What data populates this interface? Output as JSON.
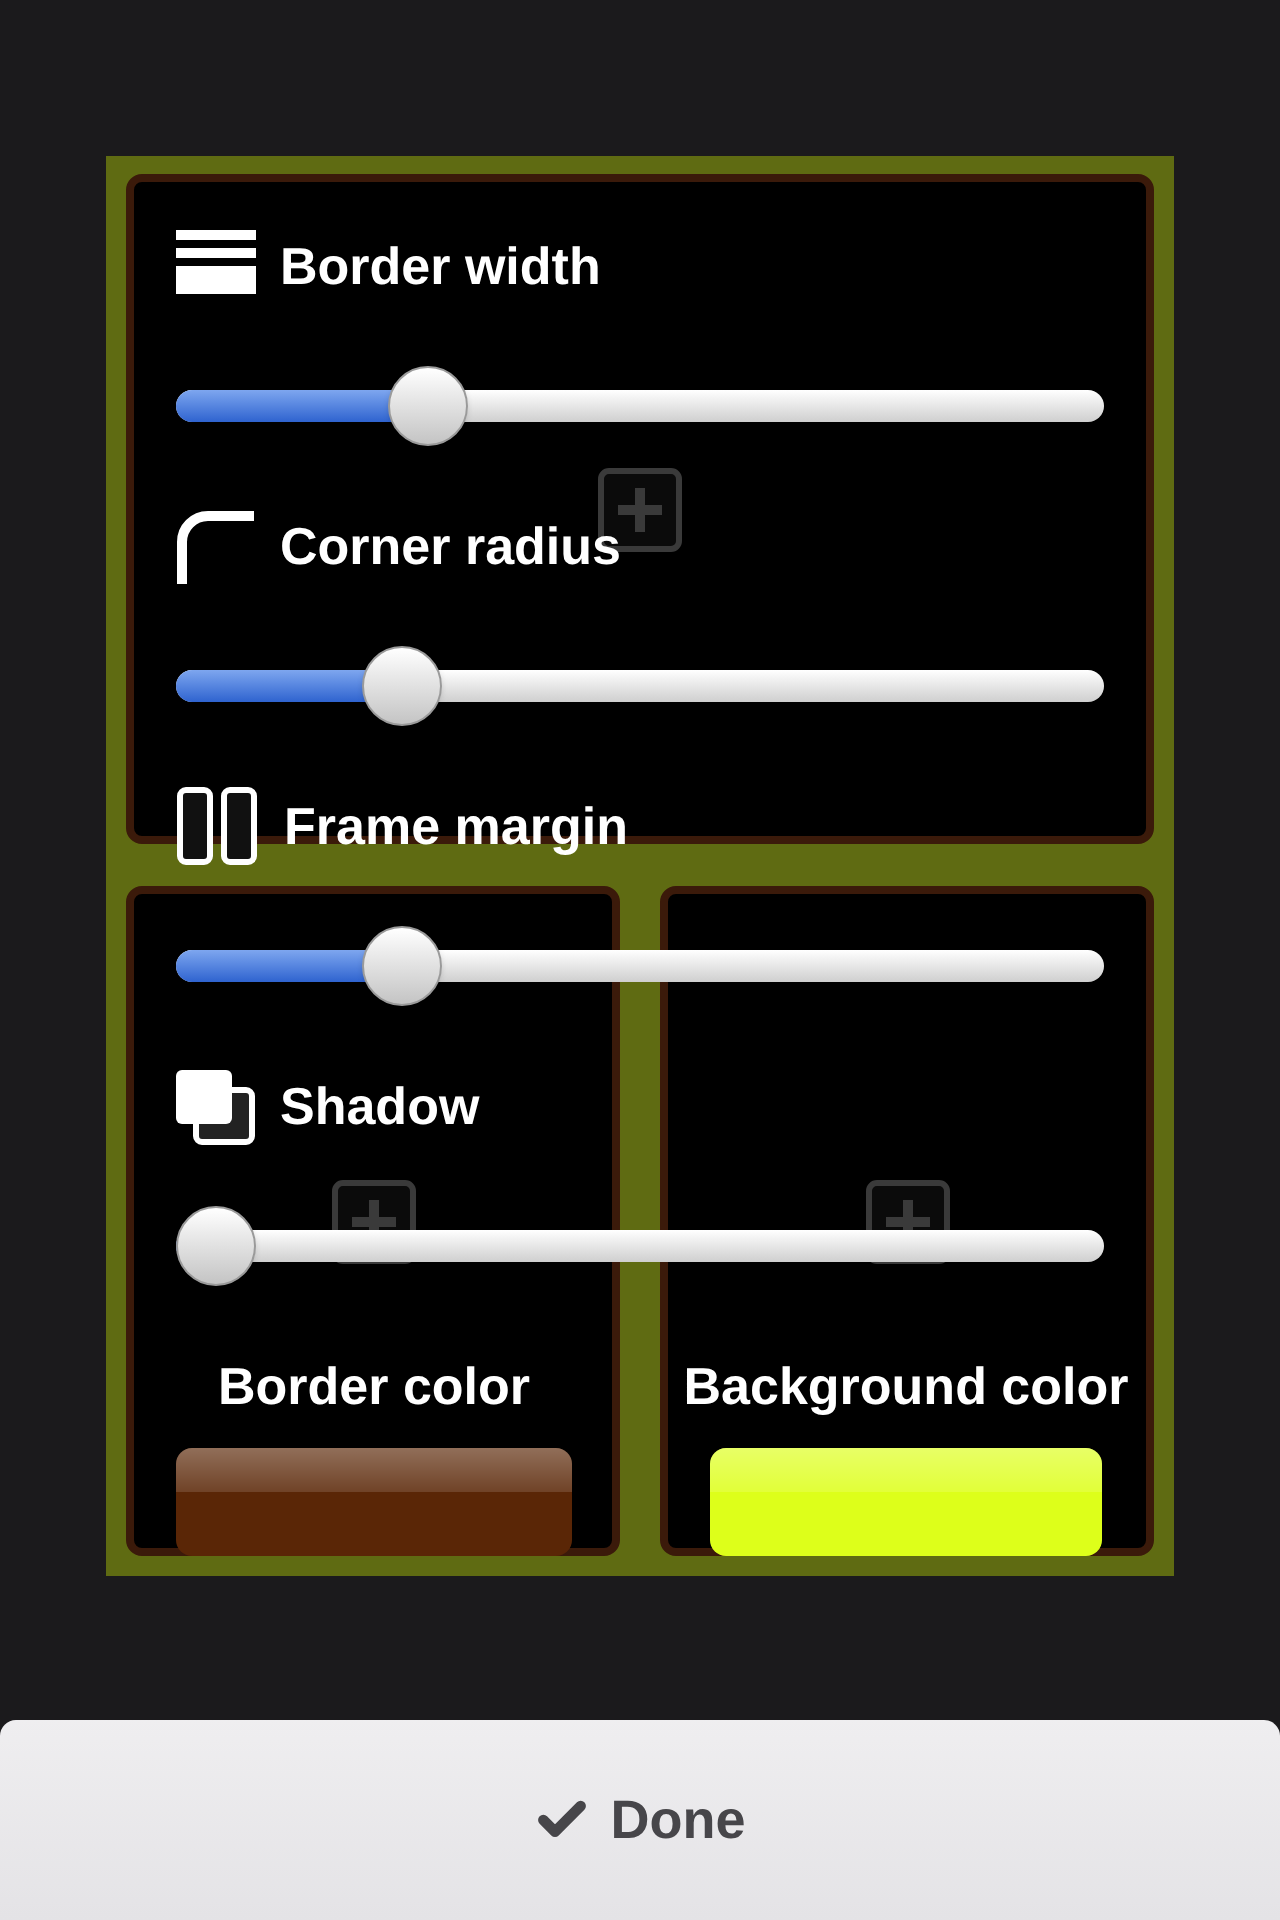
{
  "sliders": [
    {
      "label": "Border width",
      "level": 0.25
    },
    {
      "label": "Corner radius",
      "level": 0.22
    },
    {
      "label": "Frame margin",
      "level": 0.22
    },
    {
      "label": "Shadow",
      "level": 0
    }
  ],
  "colors": [
    {
      "label": "Border color",
      "color": "#5a2606"
    },
    {
      "label": "Background color",
      "color": "#ddff1a"
    }
  ],
  "done_button": {
    "label": "Done"
  }
}
